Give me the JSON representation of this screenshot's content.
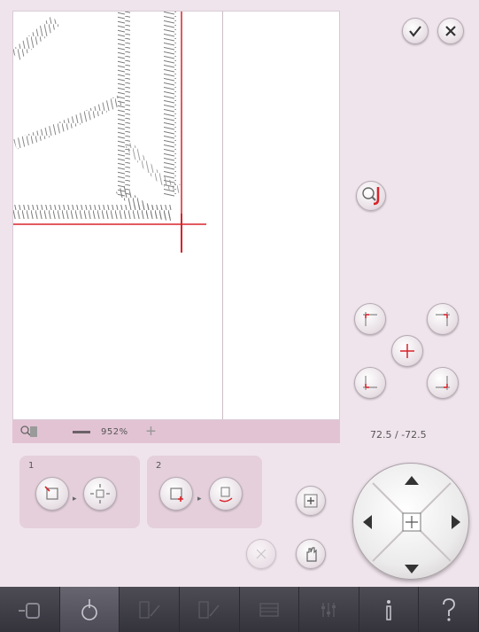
{
  "zoom": {
    "value_label": "952%"
  },
  "coords": {
    "text": "72.5 / -72.5"
  },
  "steps": [
    {
      "number": "1"
    },
    {
      "number": "2"
    }
  ],
  "accent_red": "#d8232a",
  "icons": {
    "confirm": "checkmark-icon",
    "cancel": "close-icon",
    "zoom_to_cursor": "zoom-to-cursor-icon",
    "corner_tl": "corner-top-left-icon",
    "corner_tr": "corner-top-right-icon",
    "center": "center-icon",
    "corner_bl": "corner-bottom-left-icon",
    "corner_br": "corner-bottom-right-icon"
  }
}
